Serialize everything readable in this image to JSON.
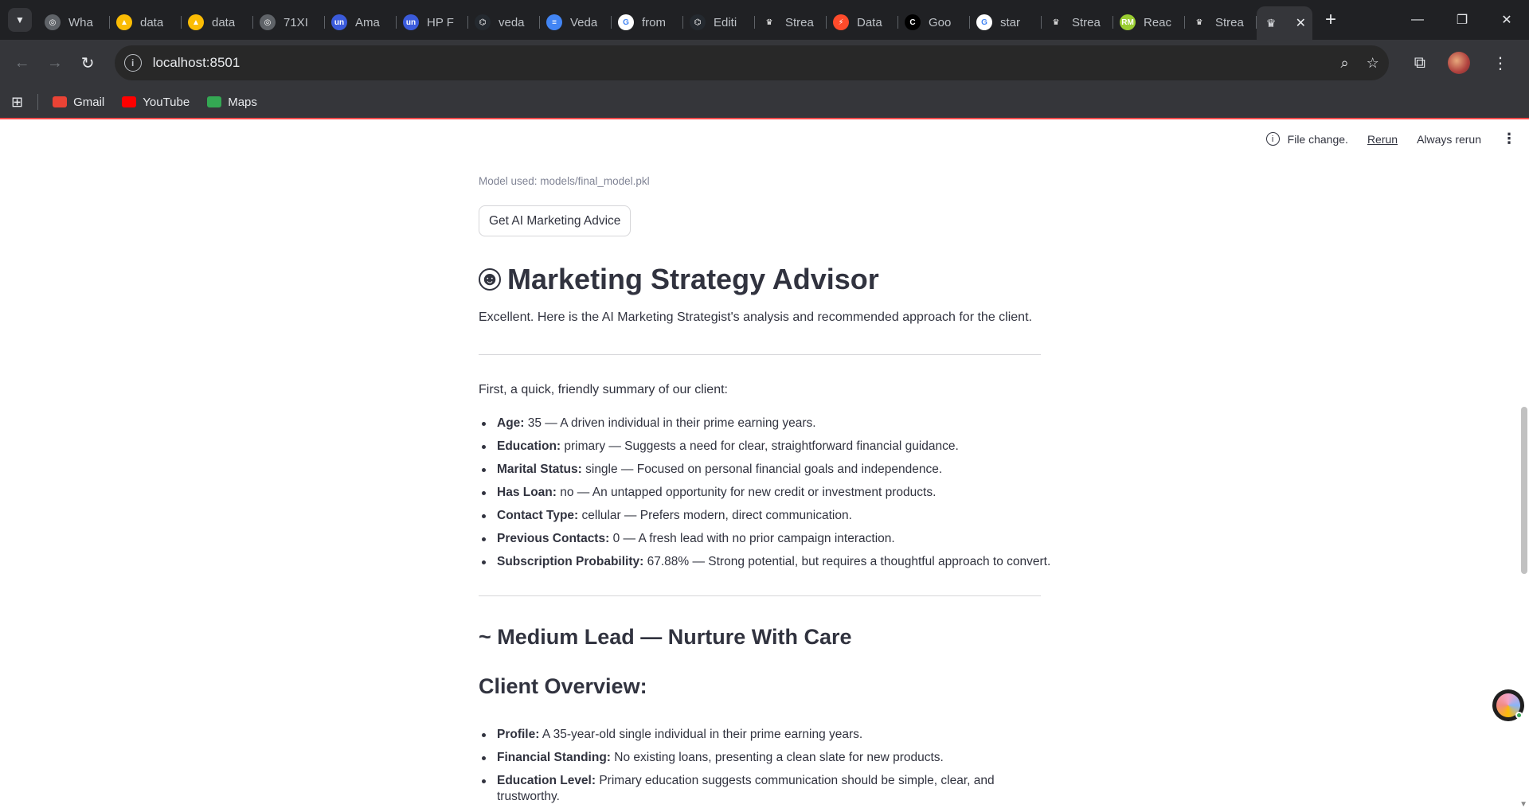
{
  "browser": {
    "tabs": [
      {
        "title": "Wha",
        "color": "#5f6368",
        "glyph": "◎"
      },
      {
        "title": "data",
        "color": "#fbbc04",
        "glyph": "▲"
      },
      {
        "title": "data",
        "color": "#fbbc04",
        "glyph": "▲"
      },
      {
        "title": "71XI",
        "color": "#5f6368",
        "glyph": "◎"
      },
      {
        "title": "Ama",
        "color": "#3b5bdb",
        "glyph": "un"
      },
      {
        "title": "HP F",
        "color": "#3b5bdb",
        "glyph": "un"
      },
      {
        "title": "veda",
        "color": "#24292f",
        "glyph": "⌬"
      },
      {
        "title": "Veda",
        "color": "#4285f4",
        "glyph": "≡"
      },
      {
        "title": "from",
        "color": "#ffffff",
        "glyph": "G"
      },
      {
        "title": "Editi",
        "color": "#24292f",
        "glyph": "⌬"
      },
      {
        "title": "Strea",
        "color": "#202124",
        "glyph": "♛"
      },
      {
        "title": "Data",
        "color": "#ff4b2b",
        "glyph": "⚡"
      },
      {
        "title": "Goo",
        "color": "#000000",
        "glyph": "C"
      },
      {
        "title": "star",
        "color": "#ffffff",
        "glyph": "G"
      },
      {
        "title": "Strea",
        "color": "#202124",
        "glyph": "♛"
      },
      {
        "title": "Reac",
        "color": "#9acd32",
        "glyph": "RM"
      },
      {
        "title": "Strea",
        "color": "#202124",
        "glyph": "♛"
      }
    ],
    "active_tab_glyph": "♛",
    "url": "localhost:8501",
    "bookmarks": [
      {
        "label": "Gmail",
        "color": "#ea4335"
      },
      {
        "label": "YouTube",
        "color": "#ff0000"
      },
      {
        "label": "Maps",
        "color": "#34a853"
      }
    ]
  },
  "status_bar": {
    "message": "File change.",
    "rerun_label": "Rerun",
    "always_rerun_label": "Always rerun"
  },
  "content": {
    "model_caption": "Model used: models/final_model.pkl",
    "advice_button": "Get AI Marketing Advice",
    "title": "Marketing Strategy Advisor",
    "intro": "Excellent. Here is the AI Marketing Strategist's analysis and recommended approach for the client.",
    "summary_intro": "First, a quick, friendly summary of our client:",
    "summary_items": [
      {
        "label": "Age:",
        "text": " 35 — A driven individual in their prime earning years."
      },
      {
        "label": "Education:",
        "text": " primary — Suggests a need for clear, straightforward financial guidance."
      },
      {
        "label": "Marital Status:",
        "text": " single — Focused on personal financial goals and independence."
      },
      {
        "label": "Has Loan:",
        "text": " no — An untapped opportunity for new credit or investment products."
      },
      {
        "label": "Contact Type:",
        "text": " cellular — Prefers modern, direct communication."
      },
      {
        "label": "Previous Contacts:",
        "text": " 0 — A fresh lead with no prior campaign interaction."
      },
      {
        "label": "Subscription Probability:",
        "text": " 67.88% — Strong potential, but requires a thoughtful approach to convert."
      }
    ],
    "lead_heading": "~ Medium Lead — Nurture With Care",
    "overview_heading": "Client Overview:",
    "overview_items": [
      {
        "label": "Profile:",
        "text": " A 35-year-old single individual in their prime earning years."
      },
      {
        "label": "Financial Standing:",
        "text": " No existing loans, presenting a clean slate for new products."
      },
      {
        "label": "Education Level:",
        "text": " Primary education suggests communication should be simple, clear, and",
        "text2": "trustworthy."
      }
    ]
  }
}
